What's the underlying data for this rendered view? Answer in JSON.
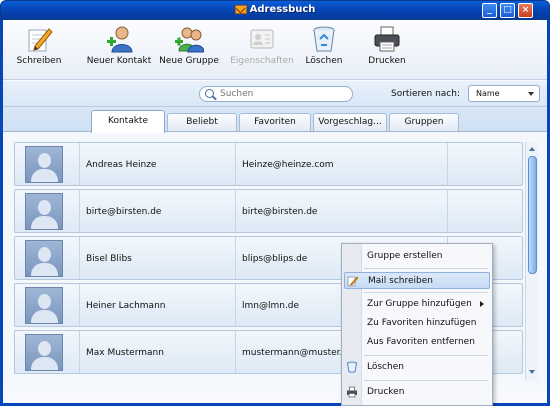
{
  "window": {
    "title": "Adressbuch",
    "accent": "#0746b8"
  },
  "toolbar": {
    "buttons": [
      {
        "label": "Schreiben",
        "icon": "pencil-icon",
        "enabled": true
      },
      {
        "label": "Neuer Kontakt",
        "icon": "add-contact-icon",
        "enabled": true
      },
      {
        "label": "Neue Gruppe",
        "icon": "add-group-icon",
        "enabled": true
      },
      {
        "label": "Eigenschaften",
        "icon": "properties-card-icon",
        "enabled": false
      },
      {
        "label": "Löschen",
        "icon": "recycle-bin-icon",
        "enabled": true
      },
      {
        "label": "Drucken",
        "icon": "printer-icon",
        "enabled": true
      }
    ]
  },
  "search": {
    "placeholder": "Suchen",
    "sort_label": "Sortieren nach:",
    "sort_value": "Name"
  },
  "tabs": [
    {
      "label": "Kontakte",
      "active": true
    },
    {
      "label": "Beliebt",
      "active": false
    },
    {
      "label": "Favoriten",
      "active": false
    },
    {
      "label": "Vorgeschlag...",
      "active": false
    },
    {
      "label": "Gruppen",
      "active": false
    }
  ],
  "contacts": [
    {
      "name": "Andreas Heinze",
      "email": "Heinze@heinze.com"
    },
    {
      "name": "birte@birsten.de",
      "email": "birte@birsten.de"
    },
    {
      "name": "Bisel Blibs",
      "email": "blips@blips.de"
    },
    {
      "name": "Heiner Lachmann",
      "email": "lmn@lmn.de"
    },
    {
      "name": "Max Mustermann",
      "email": "mustermann@muster.com"
    }
  ],
  "context_menu": {
    "items": [
      {
        "label": "Gruppe erstellen"
      },
      {
        "label": "Mail schreiben",
        "highlighted": true,
        "icon": "pencil-icon"
      },
      {
        "label": "Zur Gruppe hinzufügen",
        "submenu": true
      },
      {
        "label": "Zu Favoriten hinzufügen"
      },
      {
        "label": "Aus Favoriten entfernen"
      },
      {
        "label": "Löschen",
        "icon": "recycle-bin-icon"
      },
      {
        "label": "Drucken",
        "icon": "printer-icon"
      }
    ]
  }
}
